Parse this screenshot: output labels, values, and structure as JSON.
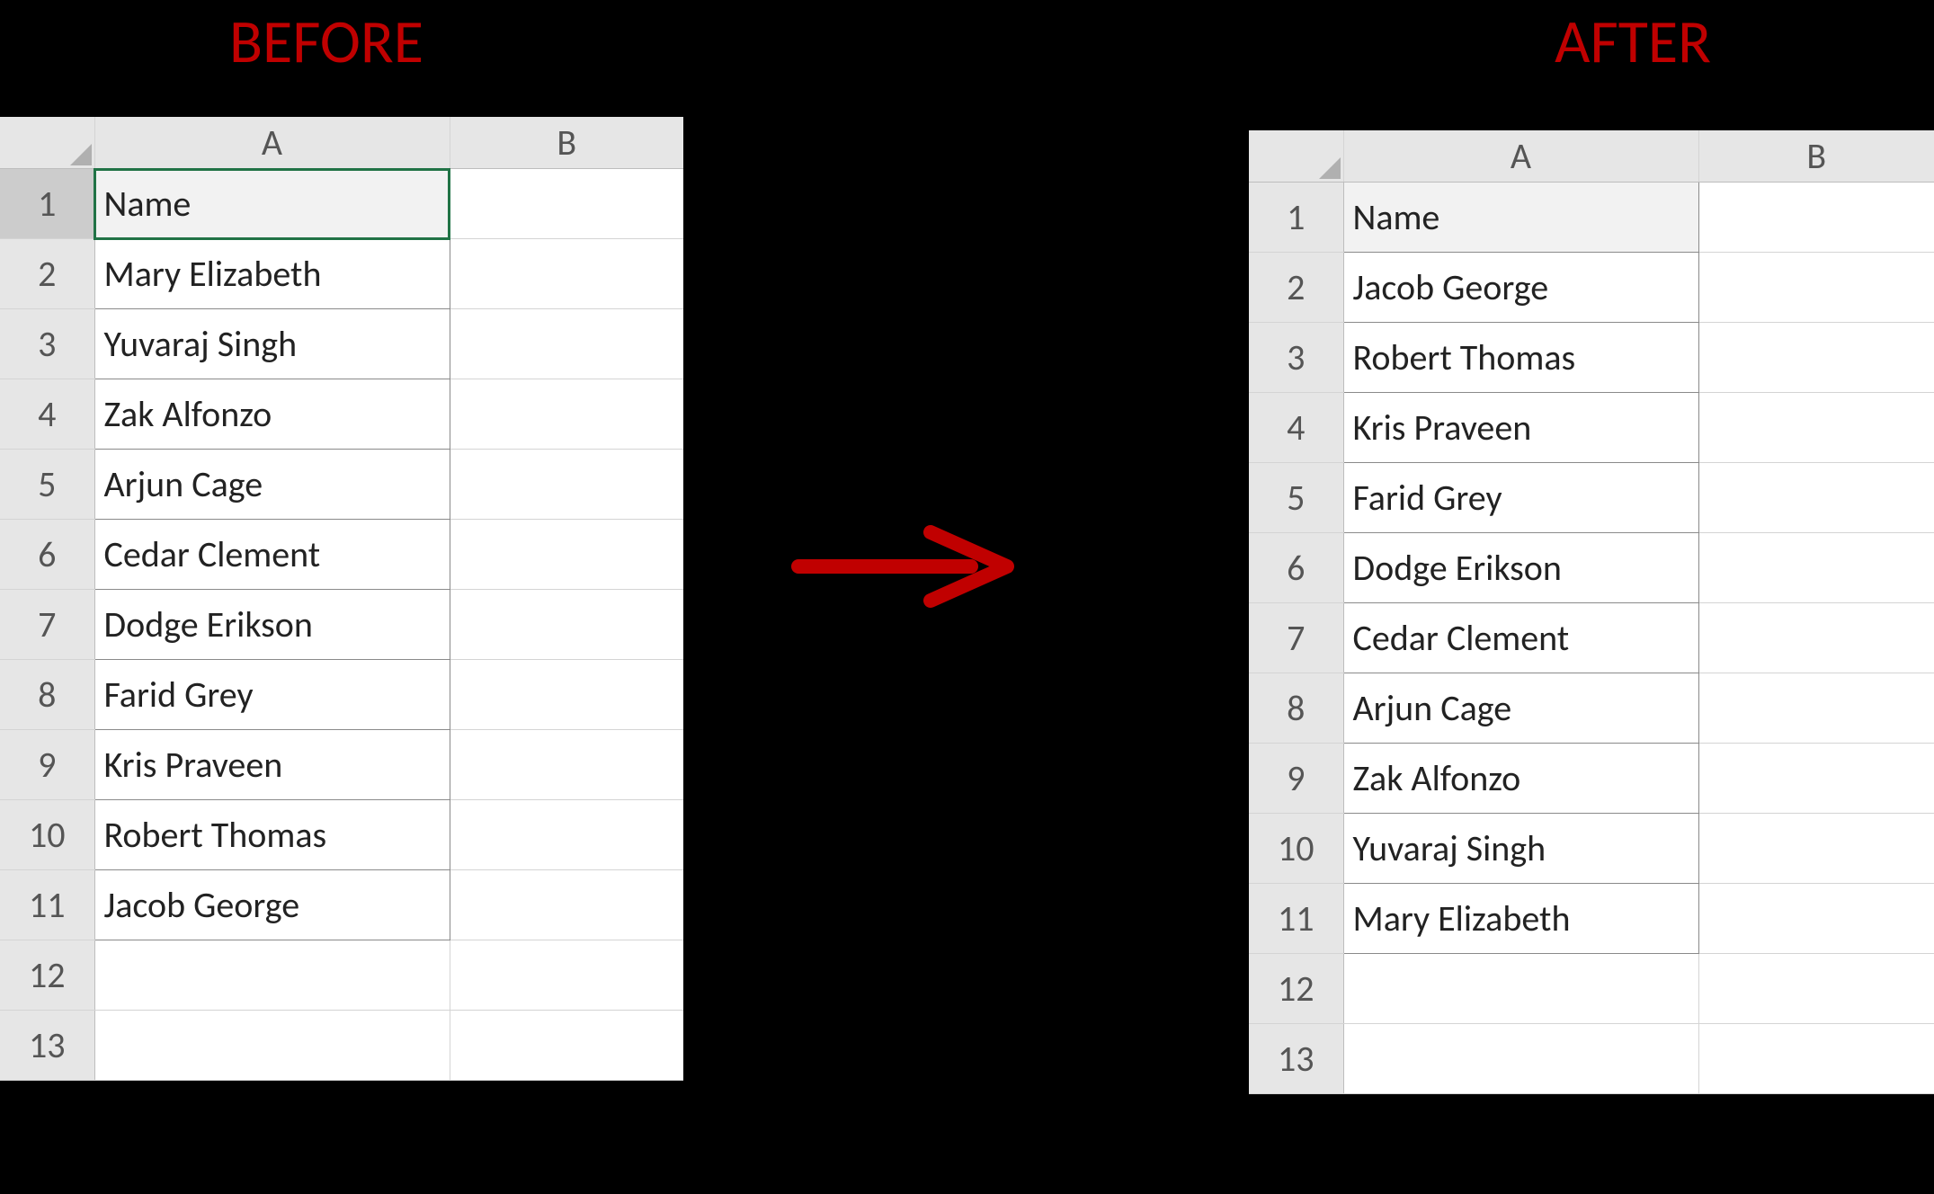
{
  "labels": {
    "before": "BEFORE",
    "after": "AFTER"
  },
  "columns": {
    "A": "A",
    "B": "B"
  },
  "row_numbers": [
    "1",
    "2",
    "3",
    "4",
    "5",
    "6",
    "7",
    "8",
    "9",
    "10",
    "11",
    "12",
    "13"
  ],
  "header_label": "Name",
  "before": {
    "A": [
      "Mary Elizabeth",
      "Yuvaraj Singh",
      "Zak Alfonzo",
      "Arjun Cage",
      "Cedar Clement",
      "Dodge Erikson",
      "Farid Grey",
      "Kris Praveen",
      "Robert Thomas",
      "Jacob George"
    ]
  },
  "after": {
    "A": [
      "Jacob George",
      "Robert Thomas",
      "Kris Praveen",
      "Farid Grey",
      "Dodge Erikson",
      "Cedar Clement",
      "Arjun Cage",
      "Zak Alfonzo",
      "Yuvaraj Singh",
      "Mary Elizabeth"
    ]
  },
  "colors": {
    "title": "#c00000",
    "arrow": "#c00000",
    "active_cell": "#217346"
  }
}
